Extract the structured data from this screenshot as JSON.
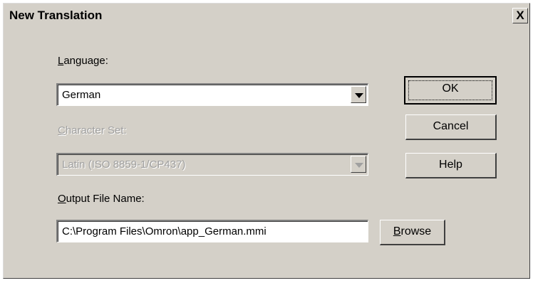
{
  "window": {
    "title": "New Translation",
    "close_label": "X"
  },
  "language": {
    "label": "Language:",
    "value": "German"
  },
  "character_set": {
    "label": "Character Set:",
    "value": "Latin (ISO 8859-1/CP437)"
  },
  "output_file": {
    "label": "Output File Name:",
    "value": "C:\\Program Files\\Omron\\app_German.mmi"
  },
  "buttons": {
    "ok": "OK",
    "cancel": "Cancel",
    "help": "Help",
    "browse": "Browse"
  }
}
